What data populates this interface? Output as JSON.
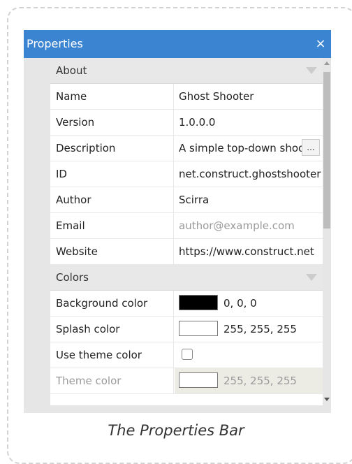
{
  "window": {
    "title": "Properties",
    "close_glyph": "×",
    "close_icon": "close-icon"
  },
  "sections": {
    "about": {
      "label": "About",
      "icon": "collapse-triangle-icon"
    },
    "colors": {
      "label": "Colors",
      "icon": "collapse-triangle-icon"
    }
  },
  "about_props": {
    "name": {
      "label": "Name",
      "value": "Ghost Shooter"
    },
    "version": {
      "label": "Version",
      "value": "1.0.0.0"
    },
    "description": {
      "label": "Description",
      "value": "A simple top-down shooter",
      "button": "..."
    },
    "id": {
      "label": "ID",
      "value": "net.construct.ghostshooter"
    },
    "author": {
      "label": "Author",
      "value": "Scirra"
    },
    "email": {
      "label": "Email",
      "placeholder": "author@example.com"
    },
    "website": {
      "label": "Website",
      "value": "https://www.construct.net"
    }
  },
  "color_props": {
    "background": {
      "label": "Background color",
      "value": "0, 0, 0",
      "swatch": "#000000"
    },
    "splash": {
      "label": "Splash color",
      "value": "255, 255, 255",
      "swatch": "#ffffff"
    },
    "use_theme": {
      "label": "Use theme color",
      "checked": false
    },
    "theme": {
      "label": "Theme color",
      "value": "255, 255, 255",
      "swatch": "#ffffff",
      "disabled": true
    }
  },
  "caption": "The Properties Bar",
  "colors": {
    "titlebar": "#3b84d2",
    "section_bg": "#e8e8e8",
    "placeholder_text": "#9a9a9a"
  }
}
